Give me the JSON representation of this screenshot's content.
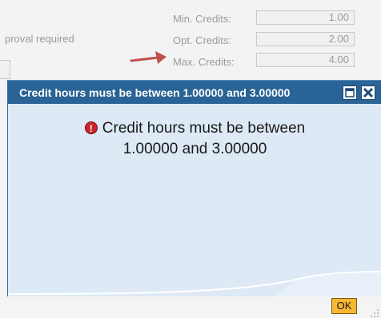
{
  "background_form": {
    "approval_text": "proval required",
    "fields": [
      {
        "label": "Min. Credits:",
        "value": "1.00"
      },
      {
        "label": "Opt. Credits:",
        "value": "2.00"
      },
      {
        "label": "Max. Credits:",
        "value": "4.00"
      }
    ]
  },
  "dialog": {
    "title": "Credit hours must be between 1.00000 and 3.00000",
    "message_line1": "Credit hours must be between",
    "message_line2": "1.00000 and 3.00000",
    "error_icon_glyph": "!",
    "ok_label": "OK",
    "icons": {
      "error": "error-icon",
      "maximize": "maximize-icon",
      "close": "close-icon"
    }
  },
  "colors": {
    "titlebar": "#2a6496",
    "dialog_bg": "#dde9f5",
    "arrow": "#c0504d",
    "ok_button": "#f7b733",
    "error": "#c9252a"
  }
}
